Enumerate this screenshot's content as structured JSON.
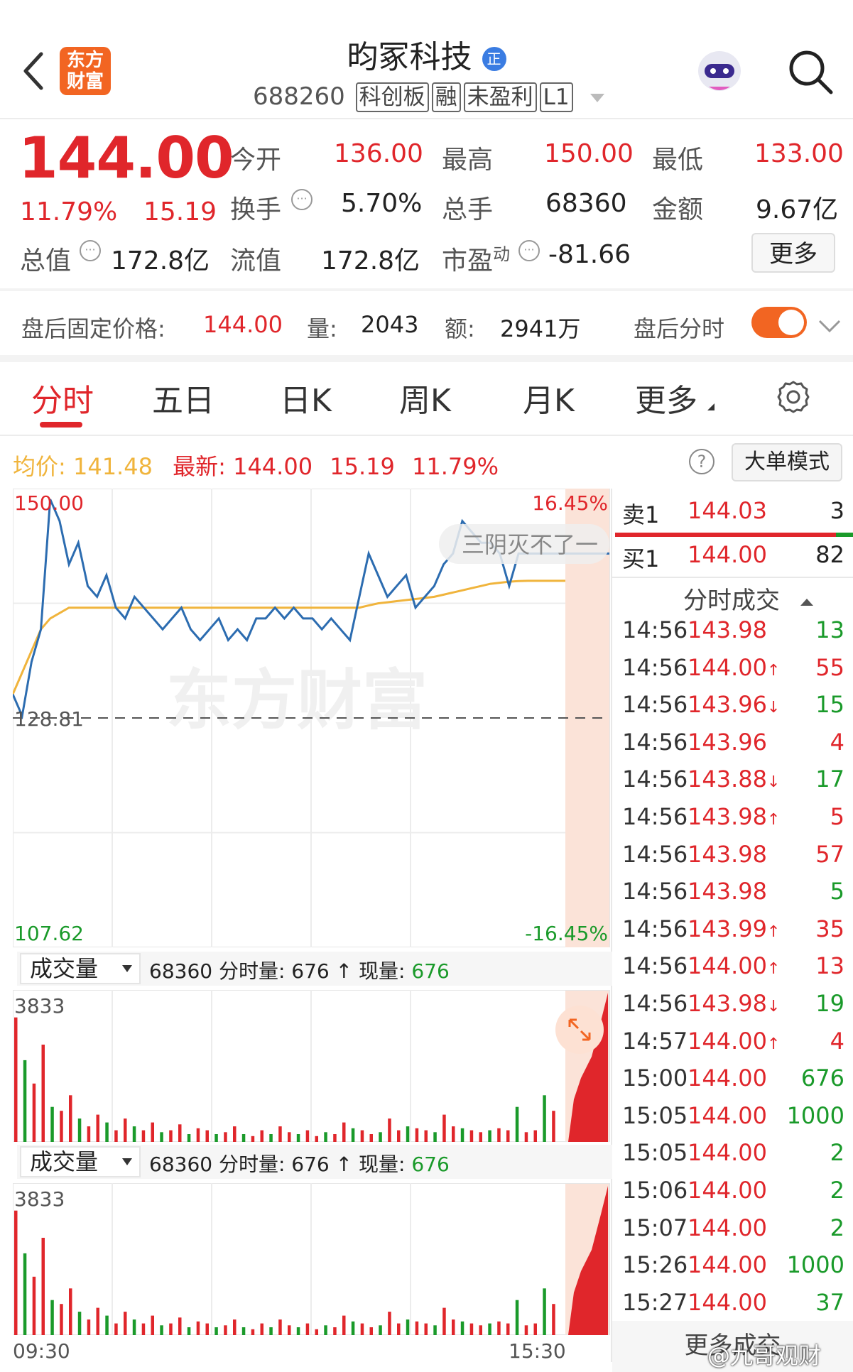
{
  "header": {
    "logo_line1": "东方",
    "logo_line2": "财富",
    "stock_name": "昀冢科技",
    "badge": "正",
    "code": "688260",
    "tags": [
      "科创板",
      "融",
      "未盈利",
      "L1"
    ]
  },
  "quote": {
    "price": "144.00",
    "change_pct": "11.79%",
    "change": "15.19",
    "fields": [
      {
        "label": "今开",
        "value": "136.00"
      },
      {
        "label": "最高",
        "value": "150.00"
      },
      {
        "label": "最低",
        "value": "133.00"
      },
      {
        "label": "换手",
        "value": "5.70%"
      },
      {
        "label": "总手",
        "value": "68360"
      },
      {
        "label": "金额",
        "value": "9.67亿"
      },
      {
        "label": "总值",
        "value": "172.8亿"
      },
      {
        "label": "流值",
        "value": "172.8亿"
      },
      {
        "label": "市盈",
        "sup": "动",
        "value": "-81.66"
      }
    ],
    "more_label": "更多"
  },
  "after_hours": {
    "label": "盘后固定价格:",
    "price": "144.00",
    "vol_label": "量:",
    "vol": "2043",
    "amt_label": "额:",
    "amt": "2941万",
    "toggle_label": "盘后分时",
    "toggle_on": true
  },
  "tabs": [
    "分时",
    "五日",
    "日K",
    "周K",
    "月K",
    "更多"
  ],
  "chart_info": {
    "avg_label": "均价:",
    "avg": "141.48",
    "latest_label": "最新:",
    "latest": "144.00",
    "change": "15.19",
    "pct": "11.79%",
    "big_order_label": "大单模式"
  },
  "chart_data": {
    "type": "line",
    "ylim": [
      107.62,
      150.0
    ],
    "y_labels": {
      "top": "150.00",
      "mid": "128.81",
      "bottom": "107.62"
    },
    "pct_labels": {
      "top": "16.45%",
      "bottom": "-16.45%"
    },
    "x_labels": [
      "09:30",
      "15:30"
    ],
    "series": [
      {
        "name": "price",
        "color": "#2c6cb0",
        "values": [
          131,
          129,
          134,
          137,
          149,
          147,
          143,
          145,
          141,
          140,
          142,
          139,
          138,
          140,
          139,
          138,
          137,
          138,
          139,
          137,
          136,
          137,
          138,
          136,
          137,
          136,
          138,
          138,
          139,
          138,
          139,
          138,
          138,
          137,
          138,
          137,
          136,
          140,
          144,
          142,
          140,
          141,
          142,
          139,
          140,
          141,
          143,
          144,
          147,
          146,
          145,
          145,
          144,
          141,
          144,
          144,
          144,
          144,
          144,
          144
        ]
      },
      {
        "name": "average",
        "color": "#f0b43c",
        "values": [
          131,
          133,
          135,
          137,
          138,
          138.5,
          139,
          139,
          139,
          139,
          139,
          139,
          139,
          139,
          139,
          139,
          139,
          139,
          139,
          139,
          139,
          139,
          139,
          139,
          139,
          139,
          139,
          139,
          139,
          139,
          139,
          139,
          139,
          139,
          139,
          139,
          139,
          139,
          139.2,
          139.4,
          139.5,
          139.6,
          139.7,
          139.8,
          139.9,
          140,
          140.2,
          140.4,
          140.6,
          140.8,
          141,
          141.2,
          141.3,
          141.4,
          141.45,
          141.48,
          141.48,
          141.48,
          141.48,
          141.48
        ]
      }
    ],
    "watermark": "东方财富",
    "overlay_text": "三阴灭不了一"
  },
  "volume_panel": {
    "selector_label": "成交量",
    "info_prefix": "68360 分时量: 676 ↑ 现量:",
    "info_value": "676",
    "max_label": "3833",
    "bars": [
      3200,
      2100,
      1500,
      2500,
      900,
      800,
      1200,
      600,
      400,
      700,
      500,
      300,
      600,
      400,
      300,
      500,
      250,
      300,
      450,
      200,
      350,
      300,
      200,
      250,
      400,
      200,
      150,
      300,
      200,
      400,
      250,
      200,
      300,
      150,
      250,
      200,
      500,
      350,
      300,
      200,
      250,
      600,
      300,
      400,
      350,
      300,
      250,
      700,
      400,
      350,
      300,
      250,
      300,
      350,
      300,
      900,
      250,
      300,
      1200,
      800
    ]
  },
  "order_book": {
    "sell_label": "卖1",
    "sell_price": "144.03",
    "sell_vol": "3",
    "buy_label": "买1",
    "buy_price": "144.00",
    "buy_vol": "82"
  },
  "trades_title": "分时成交",
  "trades": [
    {
      "time": "14:56",
      "price": "143.98",
      "arrow": "",
      "vol": "13",
      "side": "sell"
    },
    {
      "time": "14:56",
      "price": "144.00",
      "arrow": "↑",
      "vol": "55",
      "side": "buy"
    },
    {
      "time": "14:56",
      "price": "143.96",
      "arrow": "↓",
      "vol": "15",
      "side": "sell"
    },
    {
      "time": "14:56",
      "price": "143.96",
      "arrow": "",
      "vol": "4",
      "side": "buy"
    },
    {
      "time": "14:56",
      "price": "143.88",
      "arrow": "↓",
      "vol": "17",
      "side": "sell"
    },
    {
      "time": "14:56",
      "price": "143.98",
      "arrow": "↑",
      "vol": "5",
      "side": "buy"
    },
    {
      "time": "14:56",
      "price": "143.98",
      "arrow": "",
      "vol": "57",
      "side": "buy"
    },
    {
      "time": "14:56",
      "price": "143.98",
      "arrow": "",
      "vol": "5",
      "side": "sell"
    },
    {
      "time": "14:56",
      "price": "143.99",
      "arrow": "↑",
      "vol": "35",
      "side": "buy"
    },
    {
      "time": "14:56",
      "price": "144.00",
      "arrow": "↑",
      "vol": "13",
      "side": "buy"
    },
    {
      "time": "14:56",
      "price": "143.98",
      "arrow": "↓",
      "vol": "19",
      "side": "sell"
    },
    {
      "time": "14:57",
      "price": "144.00",
      "arrow": "↑",
      "vol": "4",
      "side": "buy"
    },
    {
      "time": "15:00",
      "price": "144.00",
      "arrow": "",
      "vol": "676",
      "side": "sell"
    },
    {
      "time": "15:05",
      "price": "144.00",
      "arrow": "",
      "vol": "1000",
      "side": "sell"
    },
    {
      "time": "15:05",
      "price": "144.00",
      "arrow": "",
      "vol": "2",
      "side": "sell"
    },
    {
      "time": "15:06",
      "price": "144.00",
      "arrow": "",
      "vol": "2",
      "side": "sell"
    },
    {
      "time": "15:07",
      "price": "144.00",
      "arrow": "",
      "vol": "2",
      "side": "sell"
    },
    {
      "time": "15:26",
      "price": "144.00",
      "arrow": "",
      "vol": "1000",
      "side": "sell"
    },
    {
      "time": "15:27",
      "price": "144.00",
      "arrow": "",
      "vol": "37",
      "side": "sell"
    }
  ],
  "more_trades_label": "更多成交",
  "footer_watermark": "@九哥观财",
  "colors": {
    "up": "#e0262b",
    "down": "#1a9a2a",
    "accent": "#f26522",
    "price_line": "#2c6cb0",
    "avg_line": "#f0b43c"
  }
}
